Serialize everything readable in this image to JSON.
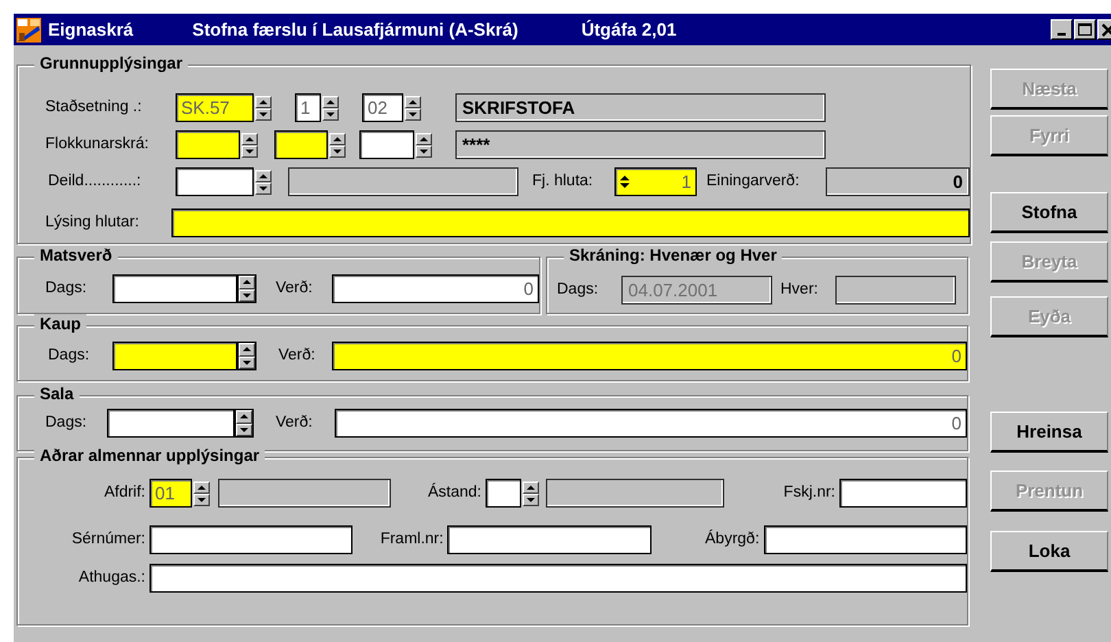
{
  "window": {
    "title": "Eignaskrá",
    "subtitle": "Stofna færslu í Lausafjármuni (A-Skrá)",
    "version": "Útgáfa 2,01"
  },
  "basic": {
    "title": "Grunnupplýsingar",
    "rows": [
      {
        "items": [
          {
            "kind": "label",
            "text": "Staðsetning .:"
          },
          {
            "kind": "spin",
            "value": "SK.57",
            "required": true
          },
          {
            "kind": "spin",
            "value": "1",
            "required": false
          },
          {
            "kind": "spin",
            "value": "02",
            "required": false
          },
          {
            "kind": "display",
            "value": "SKRIFSTOFA",
            "disabled": false
          }
        ]
      },
      {
        "items": [
          {
            "kind": "label",
            "text": "Flokkunarskrá:"
          },
          {
            "kind": "spin",
            "required": true
          },
          {
            "kind": "spin",
            "required": true
          },
          {
            "kind": "spin",
            "required": false
          },
          {
            "kind": "display",
            "value": "****",
            "disabled": false
          }
        ]
      },
      {
        "items": [
          {
            "kind": "label",
            "text": "Deild............:"
          },
          {
            "kind": "spin",
            "required": false
          },
          {
            "kind": "display"
          },
          {
            "kind": "label",
            "text": "Fj. hluta:"
          },
          {
            "kind": "updown",
            "value": "1",
            "required": true
          },
          {
            "kind": "label",
            "text": "Einingarverð:"
          },
          {
            "kind": "readout",
            "value": "0",
            "disabled": false
          }
        ]
      },
      {
        "items": [
          {
            "kind": "label",
            "text": "Lýsing hlutar:"
          },
          {
            "kind": "text",
            "required": true
          }
        ]
      }
    ]
  },
  "valuation": {
    "title": "Matsverð",
    "rows": [
      {
        "items": [
          {
            "kind": "label",
            "text": "Dags:"
          },
          {
            "kind": "date",
            "required": false
          },
          {
            "kind": "label",
            "text": "Verð:"
          },
          {
            "kind": "number",
            "value": "0",
            "required": false
          }
        ]
      }
    ]
  },
  "registration": {
    "title": "Skráning: Hvenær og Hver",
    "rows": [
      {
        "items": [
          {
            "kind": "label",
            "text": "Dags:"
          },
          {
            "kind": "display",
            "value": "04.07.2001",
            "disabled": true
          },
          {
            "kind": "label",
            "text": "Hver:"
          },
          {
            "kind": "display"
          }
        ]
      }
    ]
  },
  "purchase": {
    "title": "Kaup",
    "rows": [
      {
        "items": [
          {
            "kind": "label",
            "text": "Dags:"
          },
          {
            "kind": "date",
            "required": true
          },
          {
            "kind": "label",
            "text": "Verð:"
          },
          {
            "kind": "number",
            "value": "0",
            "required": true
          }
        ]
      }
    ]
  },
  "sale": {
    "title": "Sala",
    "rows": [
      {
        "items": [
          {
            "kind": "label",
            "text": "Dags:"
          },
          {
            "kind": "date",
            "required": false
          },
          {
            "kind": "label",
            "text": "Verð:"
          },
          {
            "kind": "number",
            "value": "0",
            "required": false
          }
        ]
      }
    ]
  },
  "other": {
    "title": "Aðrar almennar upplýsingar",
    "rows": [
      {
        "items": [
          {
            "kind": "label",
            "text": "Afdrif:"
          },
          {
            "kind": "spin",
            "value": "01",
            "required": true
          },
          {
            "kind": "display"
          },
          {
            "kind": "label",
            "text": "Ástand:"
          },
          {
            "kind": "spin",
            "required": false
          },
          {
            "kind": "display"
          },
          {
            "kind": "label",
            "text": "Fskj.nr:"
          },
          {
            "kind": "text",
            "required": false
          }
        ]
      },
      {
        "items": [
          {
            "kind": "label",
            "text": "Sérnúmer:"
          },
          {
            "kind": "text",
            "required": false
          },
          {
            "kind": "label",
            "text": "Framl.nr:"
          },
          {
            "kind": "text",
            "required": false
          },
          {
            "kind": "label",
            "text": "Ábyrgð:"
          },
          {
            "kind": "text",
            "required": false
          }
        ]
      },
      {
        "items": [
          {
            "kind": "label",
            "text": "Athugas.:"
          },
          {
            "kind": "text",
            "required": false
          }
        ]
      }
    ]
  },
  "buttons": [
    {
      "label": "Næsta",
      "disabled": true
    },
    {
      "label": "Fyrri",
      "disabled": true
    },
    {
      "label": "Stofna",
      "disabled": false
    },
    {
      "label": "Breyta",
      "disabled": true
    },
    {
      "label": "Eyða",
      "disabled": true
    },
    {
      "label": "Hreinsa",
      "disabled": false
    },
    {
      "label": "Prentun",
      "disabled": true
    },
    {
      "label": "Loka",
      "disabled": false
    }
  ]
}
